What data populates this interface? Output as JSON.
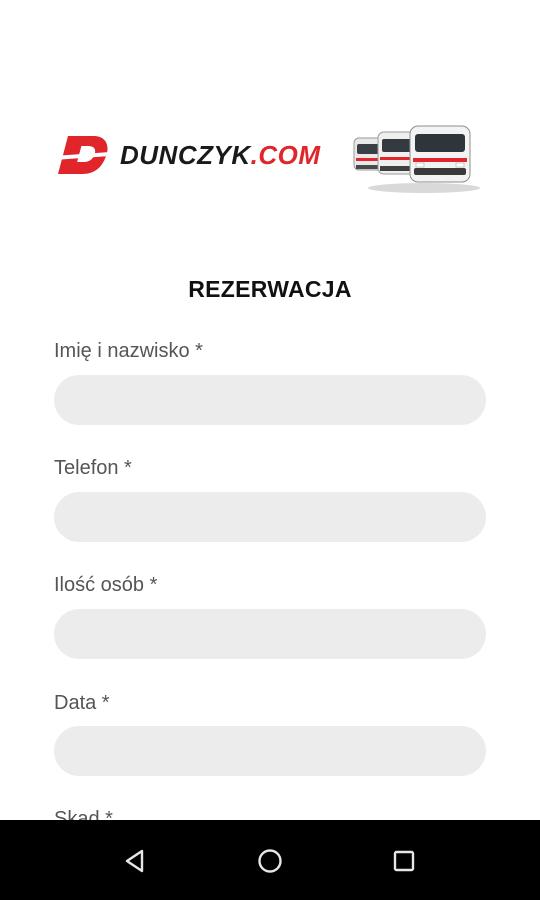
{
  "brand": {
    "name_dark": "DUNCZYK",
    "name_red": ".COM",
    "accent_color": "#e0262b"
  },
  "form": {
    "title": "REZERWACJA",
    "fields": [
      {
        "label": "Imię i nazwisko *",
        "value": "",
        "placeholder": ""
      },
      {
        "label": "Telefon *",
        "value": "",
        "placeholder": ""
      },
      {
        "label": "Ilość osób *",
        "value": "",
        "placeholder": ""
      },
      {
        "label": "Data *",
        "value": "",
        "placeholder": ""
      },
      {
        "label": "Skąd *",
        "value": "",
        "placeholder": ""
      }
    ]
  },
  "navbar": {
    "icons": [
      "back-icon",
      "home-icon",
      "recents-icon"
    ]
  }
}
